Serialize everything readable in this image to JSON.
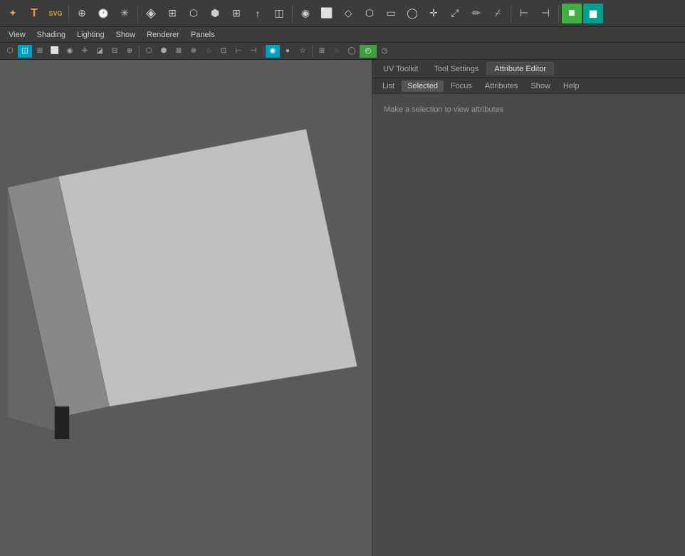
{
  "toolbar": {
    "icons": [
      {
        "name": "star-icon",
        "symbol": "✦",
        "class": "orange"
      },
      {
        "name": "text-tool-icon",
        "symbol": "T",
        "class": "orange"
      },
      {
        "name": "svg-tool-icon",
        "symbol": "SVG",
        "class": "orange"
      },
      {
        "name": "target-icon",
        "symbol": "⊕",
        "class": ""
      },
      {
        "name": "clock-icon",
        "symbol": "🕐",
        "class": ""
      },
      {
        "name": "asterisk-icon",
        "symbol": "✳",
        "class": ""
      },
      {
        "name": "cube-wire-icon",
        "symbol": "◈",
        "class": ""
      },
      {
        "name": "grid-icon",
        "symbol": "⊞",
        "class": ""
      },
      {
        "name": "cube3d-icon",
        "symbol": "⬡",
        "class": ""
      },
      {
        "name": "box-icon",
        "symbol": "⬢",
        "class": ""
      },
      {
        "name": "grid2-icon",
        "symbol": "⊞",
        "class": ""
      },
      {
        "name": "arrow-icon",
        "symbol": "↑",
        "class": ""
      },
      {
        "name": "stack-icon",
        "symbol": "◫",
        "class": ""
      },
      {
        "name": "sphere-icon",
        "symbol": "◉",
        "class": ""
      },
      {
        "name": "cube-open-icon",
        "symbol": "⬜",
        "class": ""
      },
      {
        "name": "dropbox-icon",
        "symbol": "◇",
        "class": ""
      },
      {
        "name": "hexagon-icon",
        "symbol": "⬡",
        "class": ""
      },
      {
        "name": "rectangle-icon",
        "symbol": "▭",
        "class": ""
      },
      {
        "name": "circle-icon",
        "symbol": "◯",
        "class": ""
      },
      {
        "name": "move-icon",
        "symbol": "✛",
        "class": ""
      },
      {
        "name": "scale-icon",
        "symbol": "⤢",
        "class": ""
      },
      {
        "name": "edit-icon",
        "symbol": "✏",
        "class": ""
      },
      {
        "name": "pen-icon",
        "symbol": "⌿",
        "class": ""
      },
      {
        "name": "split-icon",
        "symbol": "⊢",
        "class": ""
      },
      {
        "name": "bridge-icon",
        "symbol": "⊣",
        "class": ""
      },
      {
        "name": "green-cube-icon",
        "symbol": "■",
        "class": "green"
      },
      {
        "name": "teal-icon",
        "symbol": "◼",
        "class": "teal"
      }
    ]
  },
  "menu": {
    "items": [
      "View",
      "Shading",
      "Lighting",
      "Show",
      "Renderer",
      "Panels"
    ]
  },
  "secondary_toolbar": {
    "icons": [
      "⬡",
      "◫",
      "⊞",
      "⬜",
      "◉",
      "✛",
      "◪",
      "⊟",
      "⊕",
      "⬡",
      "⬢",
      "⊠",
      "⊕",
      "◌",
      "⊡",
      "⊢",
      "⊣",
      "◉",
      "●",
      "☆",
      "⊞",
      "◌",
      "◯",
      "⊔",
      "◴"
    ]
  },
  "right_panel": {
    "tabs": [
      {
        "label": "UV Toolkit",
        "active": false
      },
      {
        "label": "Tool Settings",
        "active": false
      },
      {
        "label": "Attribute Editor",
        "active": true
      }
    ],
    "sub_tabs": [
      {
        "label": "List",
        "active": false
      },
      {
        "label": "Selected",
        "active": true
      },
      {
        "label": "Focus",
        "active": false
      },
      {
        "label": "Attributes",
        "active": false
      },
      {
        "label": "Show",
        "active": false
      },
      {
        "label": "Help",
        "active": false
      }
    ],
    "content_message": "Make a selection to view attributes"
  },
  "viewport": {
    "background_color": "#5a5a5a"
  }
}
